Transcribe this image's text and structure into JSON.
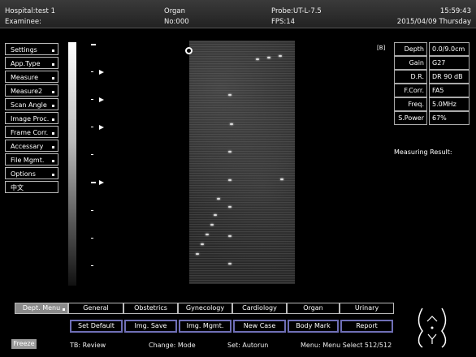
{
  "header": {
    "hospital": "Hospital:test 1",
    "examinee": "Examinee:",
    "organ": "Organ",
    "no": "No:000",
    "probe": "Probe:UT-L-7.5",
    "fps": "FPS:14",
    "time": "15:59:43",
    "date": "2015/04/09 Thursday"
  },
  "side_menu": [
    {
      "label": "Settings"
    },
    {
      "label": "App.Type"
    },
    {
      "label": "Measure"
    },
    {
      "label": "Measure2"
    },
    {
      "label": "Scan Angle"
    },
    {
      "label": "Image Proc."
    },
    {
      "label": "Frame Corr."
    },
    {
      "label": "Accessary"
    },
    {
      "label": "File Mgmt."
    },
    {
      "label": "Options"
    },
    {
      "label": "中文"
    }
  ],
  "indicator_b": "[B]",
  "params": [
    {
      "label": "Depth",
      "value": "0.0/9.0cm"
    },
    {
      "label": "Gain",
      "value": "G27"
    },
    {
      "label": "D.R.",
      "value": "DR 90 dB"
    },
    {
      "label": "F.Corr.",
      "value": "FA5"
    },
    {
      "label": "Freq.",
      "value": "5.0MHz"
    },
    {
      "label": "S.Power",
      "value": "67%"
    }
  ],
  "measuring_result": "Measuring Result:",
  "tabs": [
    {
      "label": "Dept. Menu"
    },
    {
      "label": "General"
    },
    {
      "label": "Obstetrics"
    },
    {
      "label": "Gynecology"
    },
    {
      "label": "Cardiology"
    },
    {
      "label": "Organ"
    },
    {
      "label": "Urinary"
    }
  ],
  "actions": [
    {
      "label": "Set Default"
    },
    {
      "label": "Img. Save"
    },
    {
      "label": "Img. Mgmt."
    },
    {
      "label": "New Case"
    },
    {
      "label": "Body Mark"
    },
    {
      "label": "Report"
    }
  ],
  "status": {
    "freeze": "Freeze",
    "tb": "TB: Review",
    "change": "Change: Mode",
    "set": "Set: Autorun",
    "menu": "Menu: Menu Select  512/512"
  },
  "icons": {
    "probe_marker": "probe-orientation-marker",
    "body_mark": "body-mark-icon"
  }
}
